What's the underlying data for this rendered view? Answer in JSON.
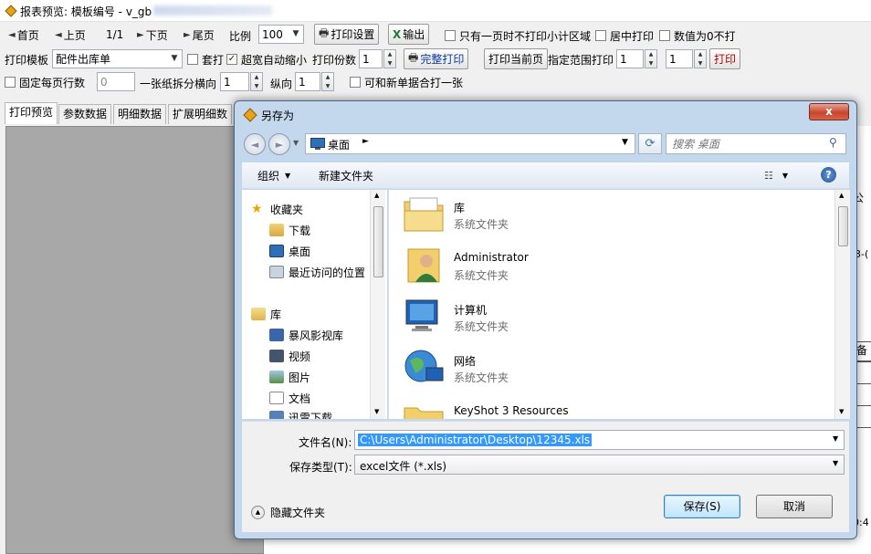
{
  "window": {
    "title": "报表预览: 模板编号 - v_gb"
  },
  "toolbar1": {
    "first": "首页",
    "prev": "上页",
    "page_indicator": "1/1",
    "next": "下页",
    "last": "尾页",
    "scale_label": "比例",
    "scale_value": "100",
    "print_settings": "打印设置",
    "export": "输出",
    "chk_single_page": "只有一页时不打印小计区域",
    "chk_center": "居中打印",
    "chk_zero": "数值为0不打"
  },
  "toolbar2": {
    "template_label": "打印模板",
    "template_value": "配件出库单",
    "chk_overlay": "套打",
    "chk_autoshrink": "超宽自动缩小",
    "copies_label": "打印份数",
    "copies_value": "1",
    "full_print": "完整打印",
    "print_current": "打印当前页",
    "range_label": "指定范围打印",
    "range_from": "1",
    "range_to": "1",
    "print": "打印"
  },
  "toolbar3": {
    "chk_fixed_rows": "固定每页行数",
    "rows_value": "0",
    "split_label": "一张纸拆分横向",
    "split_h": "1",
    "vertical_label": "纵向",
    "split_v": "1",
    "chk_merge": "可和新单据合打一张"
  },
  "tabs": [
    "打印预览",
    "参数数据",
    "明细数据",
    "扩展明细数"
  ],
  "dialog": {
    "title": "另存为",
    "close": "x",
    "address": "桌面",
    "search_placeholder": "搜索 桌面",
    "organize": "组织",
    "new_folder": "新建文件夹",
    "help": "?",
    "nav": {
      "favorites": "收藏夹",
      "fav_items": [
        "下载",
        "桌面",
        "最近访问的位置"
      ],
      "libraries": "库",
      "lib_items": [
        "暴风影视库",
        "视频",
        "图片",
        "文档",
        "迅雷下载"
      ]
    },
    "items": [
      {
        "name": "库",
        "type": "系统文件夹"
      },
      {
        "name": "Administrator",
        "type": "系统文件夹"
      },
      {
        "name": "计算机",
        "type": "系统文件夹"
      },
      {
        "name": "网络",
        "type": "系统文件夹"
      },
      {
        "name": "KeyShot 3 Resources",
        "type": ""
      }
    ],
    "filename_label": "文件名(N):",
    "filename_value": "C:\\Users\\Administrator\\Desktop\\12345.xls",
    "filetype_label": "保存类型(T):",
    "filetype_value": "excel文件 (*.xls)",
    "hide_folders": "隐藏文件夹",
    "save": "保存(S)",
    "cancel": "取消"
  },
  "right_edge": {
    "frag1": "公",
    "frag2": "3-(",
    "frag3": "备",
    "frag4": "0:4"
  },
  "colors": {
    "selection": "#3399ff",
    "dialog_frame": "#c3d7ed",
    "close_red": "#c8452c"
  }
}
